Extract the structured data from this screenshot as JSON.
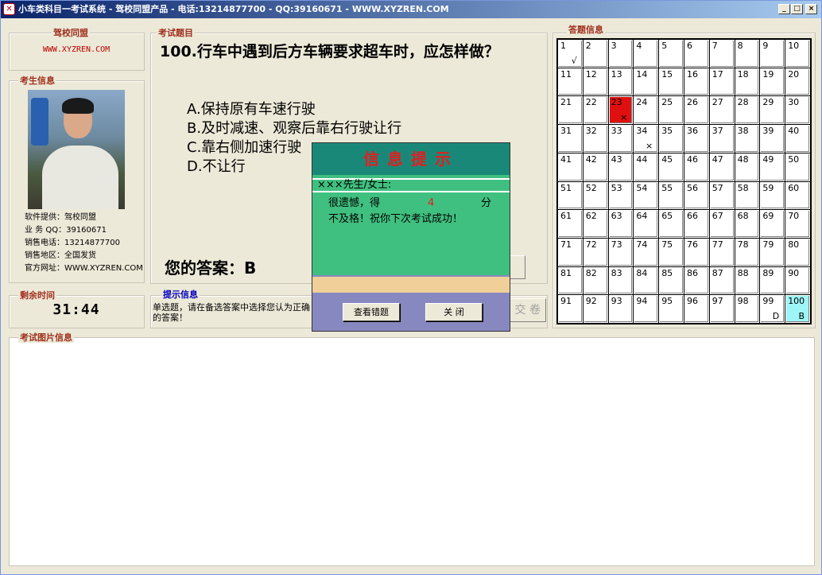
{
  "window": {
    "title": "小车类科目一考试系统 - 驾校同盟产品 - 电话:13214877700 - QQ:39160671 - WWW.XYZREN.COM",
    "app_icon": "logo-icon",
    "controls": {
      "minimize": "_",
      "maximize": "□",
      "close": "×"
    }
  },
  "school": {
    "title": "驾校同盟",
    "link": "WWW.XYZREN.COM"
  },
  "examinee": {
    "title": "考生信息",
    "photo": "examinee-photo",
    "lines": [
      "软件提供：驾校同盟",
      "业 务 QQ：39160671",
      "销售电话：13214877700",
      "销售地区：全国发货",
      "官方网址：WWW.XYZREN.COM"
    ]
  },
  "time": {
    "title": "剩余时间",
    "value": "31:44"
  },
  "exam": {
    "title": "考试题目",
    "question": "100.行车中遇到后方车辆要求超车时，应怎样做？",
    "options": [
      "A.保持原有车速行驶",
      "B.及时减速、观察后靠右行驶让行",
      "C.靠右侧加速行驶",
      "D.不让行"
    ],
    "your_answer": "您的答案：B",
    "submit_label": "交 卷"
  },
  "hint": {
    "title": "提示信息",
    "text": "单选题，请在备选答案中选择您认为正确的答案！"
  },
  "picture": {
    "title": "考试图片信息"
  },
  "answers": {
    "title": "答题信息",
    "cells": [
      {
        "n": "1",
        "mark": "√"
      },
      {
        "n": "23",
        "mark": "×",
        "state": "wrong-red"
      },
      {
        "n": "34",
        "mark": "×"
      },
      {
        "n": "99",
        "mark": "D"
      },
      {
        "n": "100",
        "mark": "B",
        "state": "current"
      }
    ]
  },
  "dialog": {
    "title": "信息提示",
    "name": "×××先生/女士:",
    "msg1": "很遗憾，得",
    "score": "4",
    "unit": "分",
    "msg2": "不及格！祝你下次考试成功！",
    "review_label": "查看错题",
    "close_label": "关  闭"
  },
  "colors": {
    "accent_red": "#a0301e",
    "dialog_head": "#1a8878",
    "dialog_body": "#40c080",
    "current_cell": "#9ef5f5",
    "wrong_cell": "#e01010"
  }
}
